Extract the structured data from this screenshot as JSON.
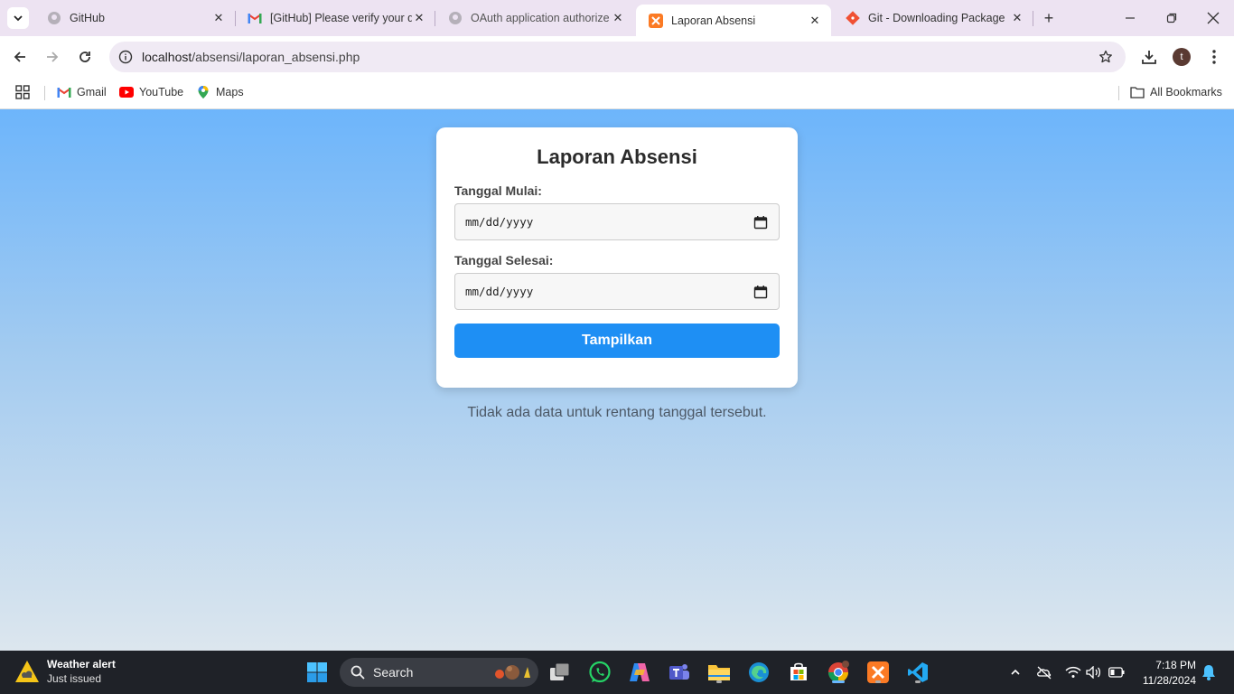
{
  "browser": {
    "tabs": [
      {
        "title": "GitHub",
        "favicon": "github-icon",
        "active": false
      },
      {
        "title": "[GitHub] Please verify your d",
        "favicon": "gmail-icon",
        "active": false
      },
      {
        "title": "OAuth application authorize",
        "favicon": "github-icon",
        "active": false
      },
      {
        "title": "Laporan Absensi",
        "favicon": "xampp-icon",
        "active": true
      },
      {
        "title": "Git - Downloading Package",
        "favicon": "git-icon",
        "active": false
      }
    ],
    "url_host": "localhost",
    "url_path": "/absensi/laporan_absensi.php",
    "profile_initial": "t",
    "bookmarks": [
      {
        "label": "Gmail",
        "icon": "gmail-icon"
      },
      {
        "label": "YouTube",
        "icon": "youtube-icon"
      },
      {
        "label": "Maps",
        "icon": "maps-icon"
      }
    ],
    "all_bookmarks_label": "All Bookmarks"
  },
  "page": {
    "title": "Laporan Absensi",
    "start_label": "Tanggal Mulai:",
    "start_value": "mm/dd/yyyy",
    "end_label": "Tanggal Selesai:",
    "end_value": "mm/dd/yyyy",
    "submit_label": "Tampilkan",
    "empty_message": "Tidak ada data untuk rentang tanggal tersebut.",
    "colors": {
      "primary_button": "#1e8ff4",
      "bg_top": "#6db5fb",
      "bg_bottom": "#dce6ee"
    }
  },
  "taskbar": {
    "weather_title": "Weather alert",
    "weather_sub": "Just issued",
    "search_label": "Search",
    "time": "7:18 PM",
    "date": "11/28/2024",
    "apps": [
      "start-icon",
      "search-icon",
      "task-view-icon",
      "whatsapp-icon",
      "copilot-icon",
      "teams-icon",
      "file-explorer-icon",
      "edge-icon",
      "store-icon",
      "chrome-icon",
      "xampp-icon",
      "vscode-icon"
    ]
  }
}
